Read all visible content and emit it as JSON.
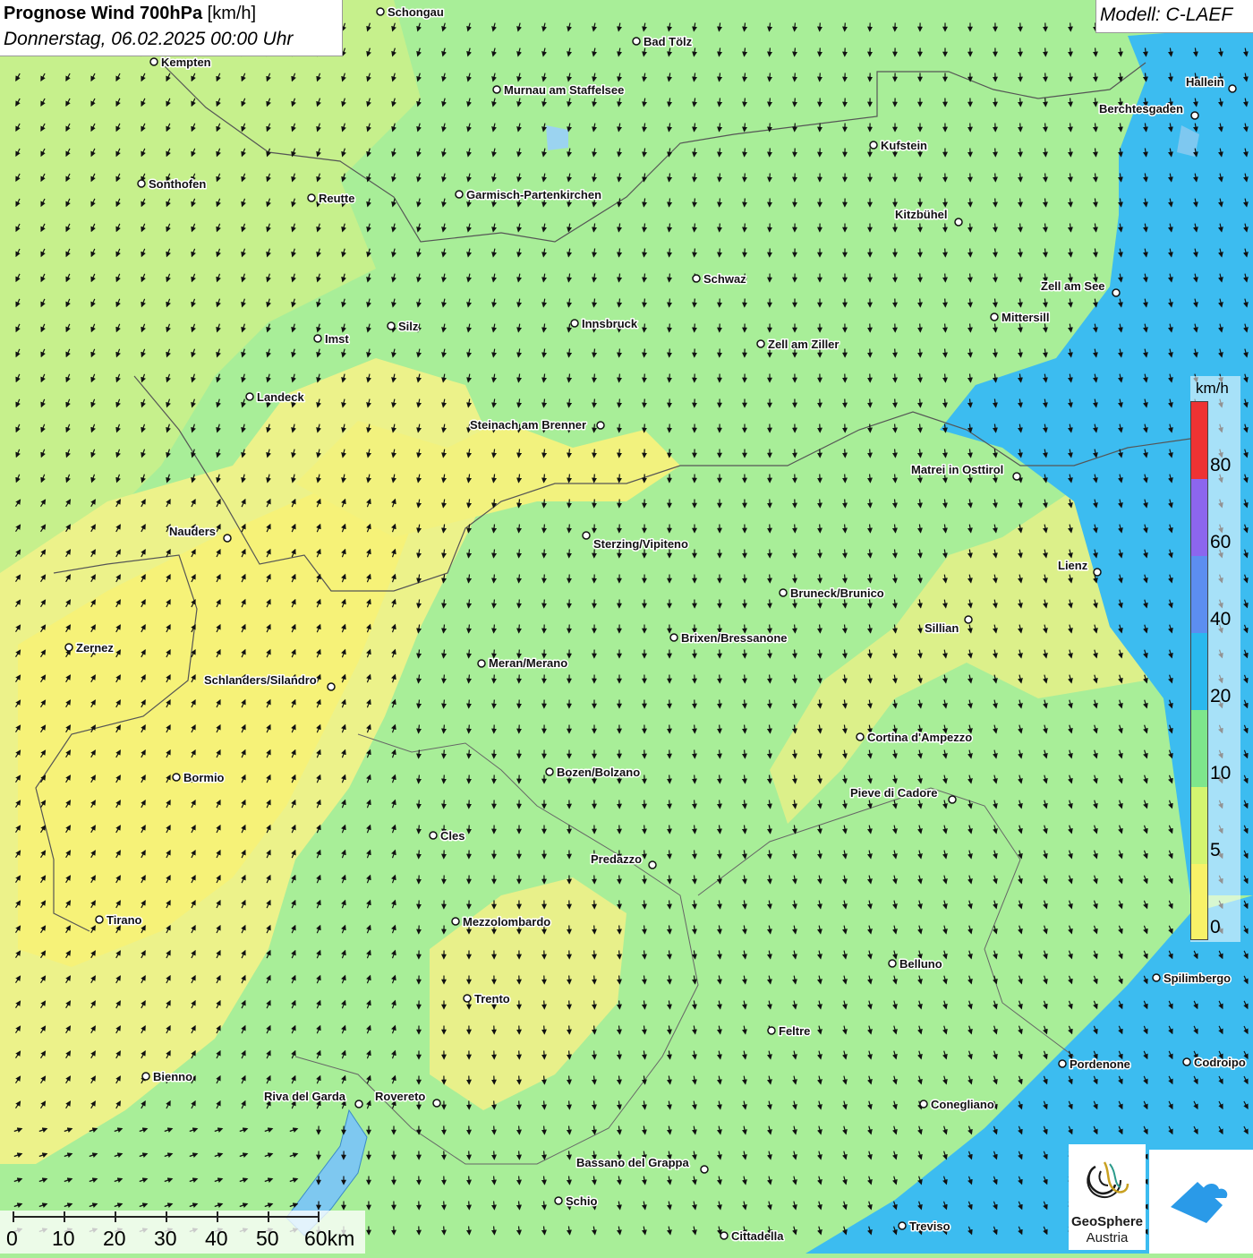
{
  "title": {
    "main": "Prognose Wind 700hPa",
    "unit": "[km/h]",
    "date": "Donnerstag, 06.02.2025 00:00 Uhr"
  },
  "model": "Modell: C-LAEF",
  "legend": {
    "unit": "km/h",
    "labels": [
      "80",
      "60",
      "40",
      "20",
      "10",
      "5",
      "0"
    ],
    "colors": [
      "#ee3333",
      "#8c66ee",
      "#5c8ef0",
      "#2ab8ee",
      "#7ee68c",
      "#d4f570",
      "#f8f268"
    ],
    "bin_edges": [
      0,
      5,
      10,
      20,
      40,
      60,
      80,
      100
    ]
  },
  "scale_bar": {
    "labels": [
      "0",
      "10",
      "20",
      "30",
      "40",
      "50",
      "60km"
    ]
  },
  "cities": [
    {
      "name": "Schongau"
    },
    {
      "name": "Bad Tölz"
    },
    {
      "name": "Kempten"
    },
    {
      "name": "Murnau am Staffelsee"
    },
    {
      "name": "Hallein"
    },
    {
      "name": "Berchtesgaden"
    },
    {
      "name": "Kufstein"
    },
    {
      "name": "Sonthofen"
    },
    {
      "name": "Reutte"
    },
    {
      "name": "Garmisch-Partenkirchen"
    },
    {
      "name": "Kitzbühel"
    },
    {
      "name": "Schwaz"
    },
    {
      "name": "Zell am See"
    },
    {
      "name": "Mittersill"
    },
    {
      "name": "Silz"
    },
    {
      "name": "Innsbruck"
    },
    {
      "name": "Imst"
    },
    {
      "name": "Zell am Ziller"
    },
    {
      "name": "Landeck"
    },
    {
      "name": "Steinach am Brenner"
    },
    {
      "name": "Matrei in Osttirol"
    },
    {
      "name": "Nauders"
    },
    {
      "name": "Sterzing/Vipiteno"
    },
    {
      "name": "Lienz"
    },
    {
      "name": "Bruneck/Brunico"
    },
    {
      "name": "Sillian"
    },
    {
      "name": "Zernez"
    },
    {
      "name": "Brixen/Bressanone"
    },
    {
      "name": "Meran/Merano"
    },
    {
      "name": "Schlanders/Silandro"
    },
    {
      "name": "Cortina d'Ampezzo"
    },
    {
      "name": "Bozen/Bolzano"
    },
    {
      "name": "Bormio"
    },
    {
      "name": "Pieve di Cadore"
    },
    {
      "name": "Cles"
    },
    {
      "name": "Predazzo"
    },
    {
      "name": "Tirano"
    },
    {
      "name": "Mezzolombardo"
    },
    {
      "name": "Belluno"
    },
    {
      "name": "Spilimbergo"
    },
    {
      "name": "Trento"
    },
    {
      "name": "Feltre"
    },
    {
      "name": "Pordenone"
    },
    {
      "name": "Codroipo"
    },
    {
      "name": "Bienno"
    },
    {
      "name": "Riva del Garda"
    },
    {
      "name": "Rovereto"
    },
    {
      "name": "Conegliano"
    },
    {
      "name": "Bassano del Grappa"
    },
    {
      "name": "Schio"
    },
    {
      "name": "Treviso"
    },
    {
      "name": "Cittadella"
    }
  ],
  "logos": {
    "geosphere_line1": "GeoSphere",
    "geosphere_line2": "Austria"
  }
}
